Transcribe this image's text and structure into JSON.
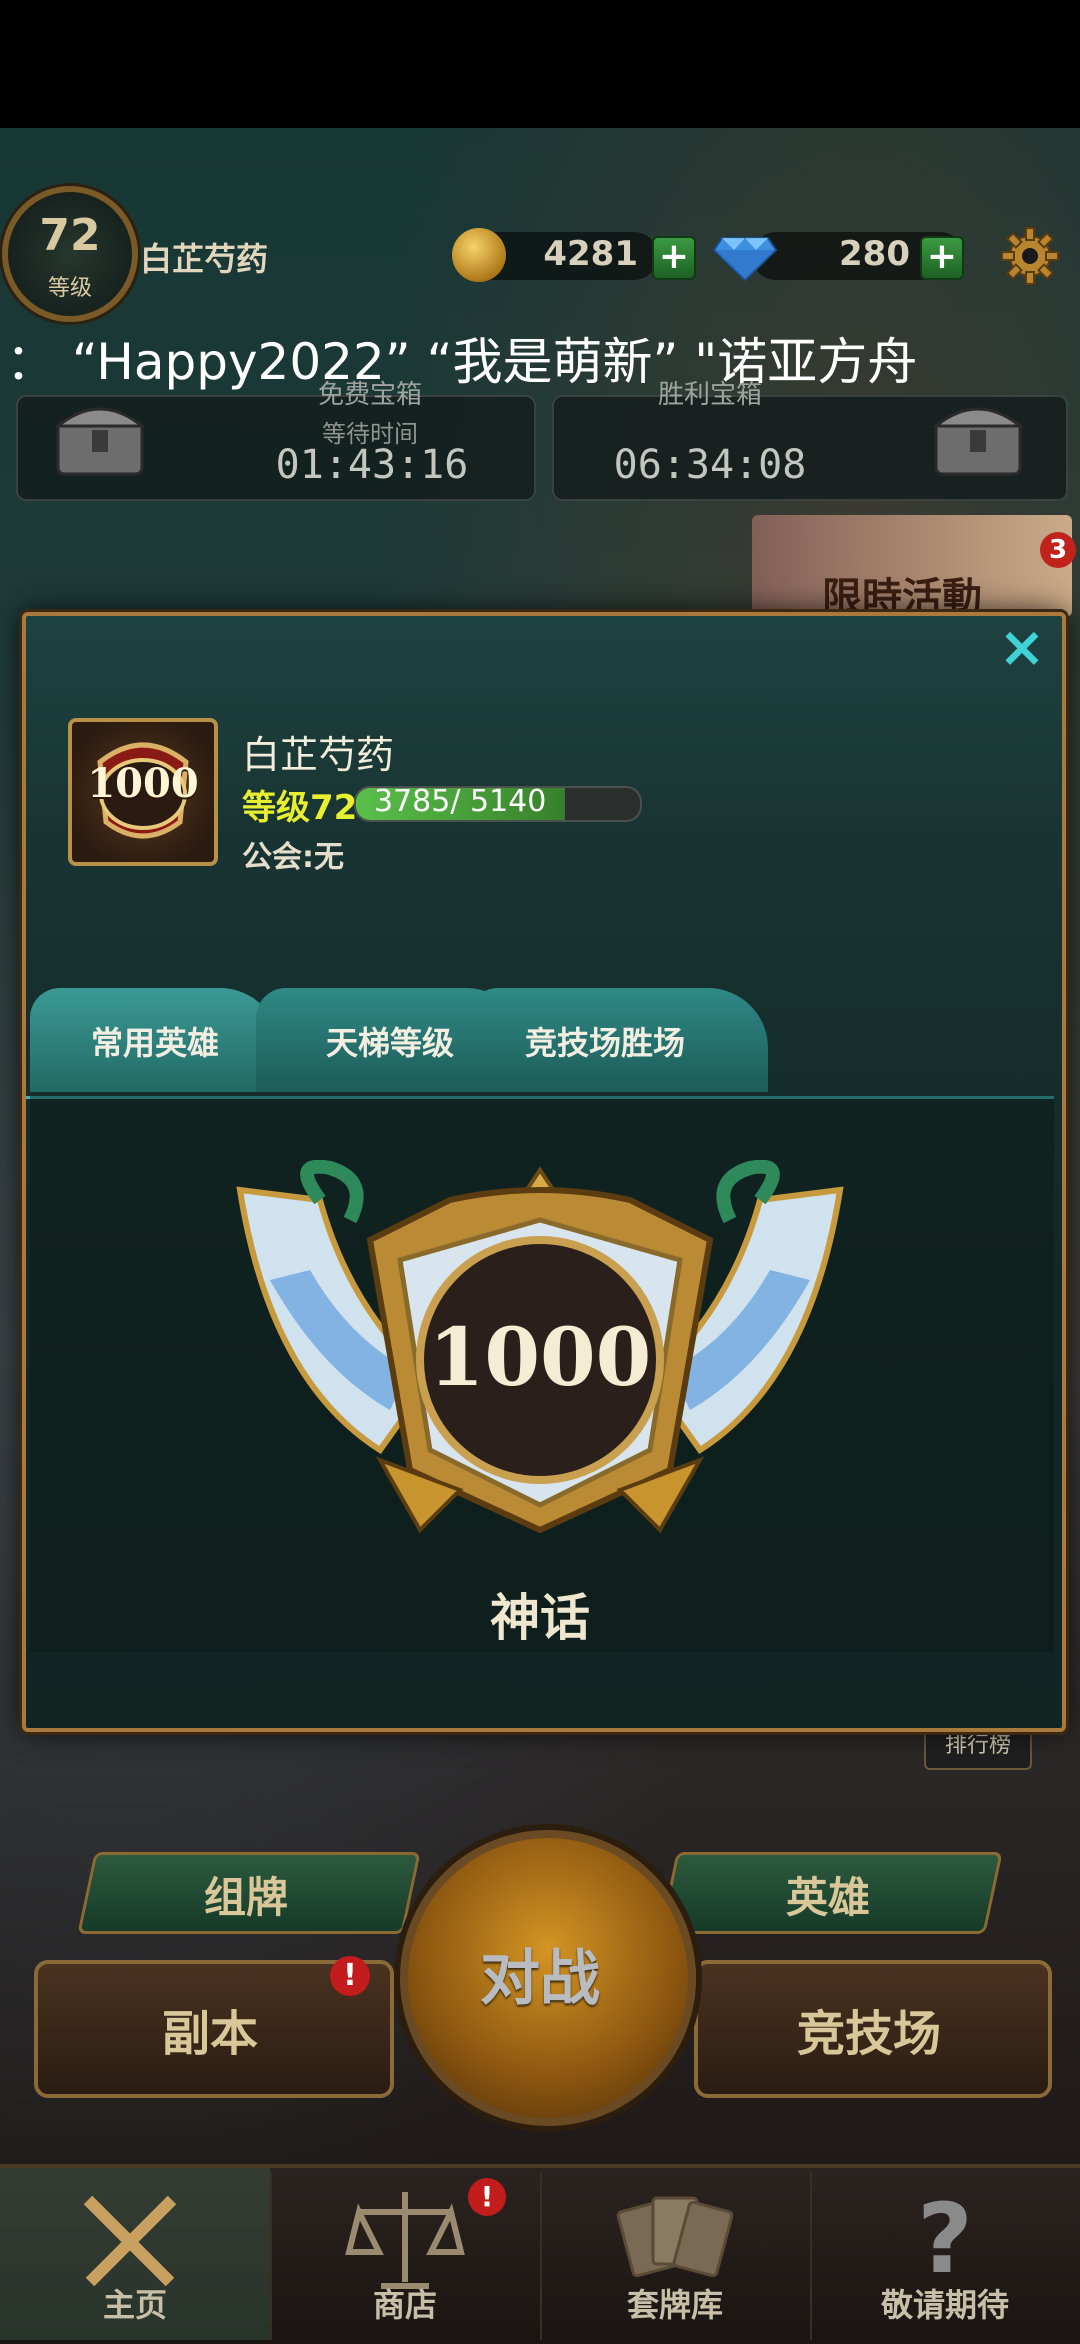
{
  "top_bar": {
    "level": "72",
    "level_label": "等级",
    "player_name": "白芷芍药",
    "gold": "4281",
    "gems": "280",
    "plus": "+"
  },
  "marquee": "：  “Happy2022”    “我是萌新”   \"诺亚方舟",
  "chests": {
    "free_chest_title": "免费宝箱",
    "wait_label": "等待时间",
    "free_chest_time": "01:43:16",
    "victory_chest_title": "胜利宝箱",
    "victory_chest_time": "06:34:08"
  },
  "event": {
    "label": "限時活動",
    "badge": "3"
  },
  "profile": {
    "name": "白芷芍药",
    "avatar_rank": "1000",
    "level_text": "等级72",
    "xp": "3785/ 5140",
    "xp_fraction": 0.736,
    "guild": "公会:无",
    "close": "×"
  },
  "tabs": [
    "常用英雄",
    "天梯等级",
    "竞技场胜场"
  ],
  "rank": {
    "value": "1000",
    "title": "神话"
  },
  "leaderboard": "排行榜",
  "actions": {
    "deck": "组牌",
    "hero": "英雄",
    "dungeon": "副本",
    "battle": "对战",
    "arena": "竞技场",
    "alert": "!"
  },
  "nav": {
    "home": "主页",
    "shop": "商店",
    "decks": "套牌库",
    "soon": "敬请期待"
  },
  "colors": {
    "accent": "#3fd2d6",
    "frame_gold": "#a97a3c",
    "xp_green": "#5ac04a",
    "level_yellow": "#e8ee30"
  }
}
